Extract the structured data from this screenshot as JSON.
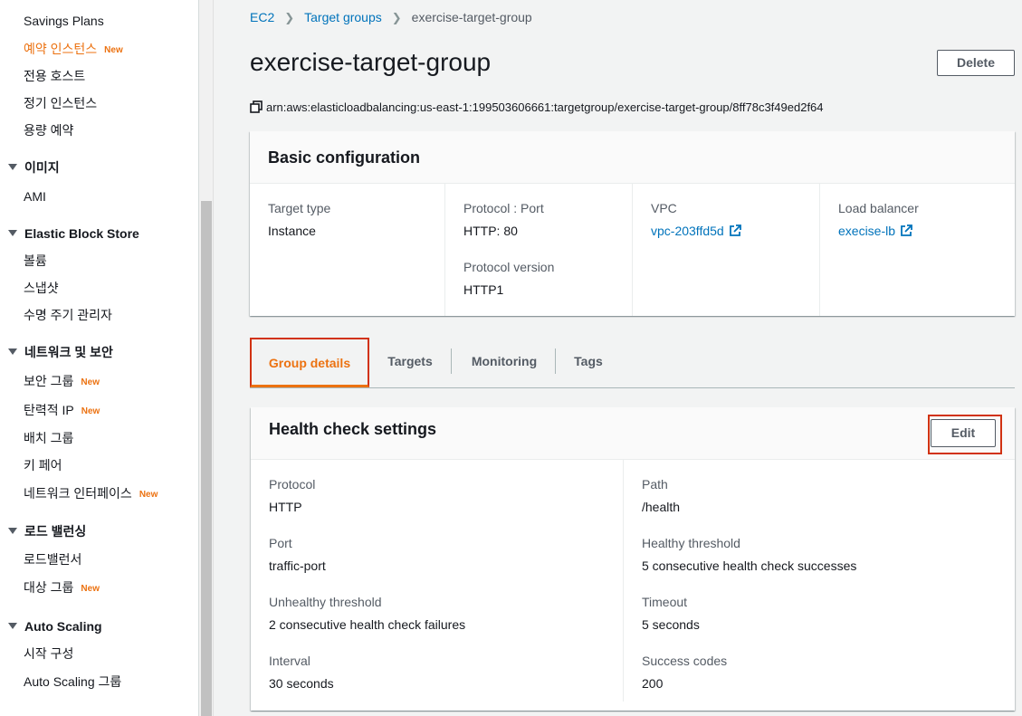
{
  "sidebar": {
    "items": [
      {
        "label": "Savings Plans",
        "active": false,
        "new": ""
      },
      {
        "label": "예약 인스턴스",
        "active": true,
        "new": "New"
      },
      {
        "label": "전용 호스트",
        "active": false,
        "new": ""
      },
      {
        "label": "정기 인스턴스",
        "active": false,
        "new": ""
      },
      {
        "label": "용량 예약",
        "active": false,
        "new": ""
      }
    ],
    "sections": {
      "images": {
        "title": "이미지",
        "items": [
          "AMI"
        ]
      },
      "ebs": {
        "title": "Elastic Block Store",
        "items": [
          "볼륨",
          "스냅샷",
          "수명 주기 관리자"
        ]
      },
      "network": {
        "title": "네트워크 및 보안",
        "items": [
          "보안 그룹",
          "탄력적 IP",
          "배치 그룹",
          "키 페어",
          "네트워크 인터페이스"
        ]
      },
      "lb": {
        "title": "로드 밸런싱",
        "items": [
          "로드밸런서",
          "대상 그룹"
        ]
      },
      "autoscaling": {
        "title": "Auto Scaling",
        "items": [
          "시작 구성",
          "Auto Scaling 그룹"
        ]
      }
    },
    "new_badge": "New"
  },
  "breadcrumb": {
    "root": "EC2",
    "parent": "Target groups",
    "current": "exercise-target-group"
  },
  "page": {
    "title": "exercise-target-group",
    "delete_label": "Delete",
    "arn": "arn:aws:elasticloadbalancing:us-east-1:199503606661:targetgroup/exercise-target-group/8ff78c3f49ed2f64"
  },
  "basic": {
    "title": "Basic configuration",
    "target_type_label": "Target type",
    "target_type_value": "Instance",
    "protocol_port_label": "Protocol : Port",
    "protocol_port_value": "HTTP: 80",
    "protocol_version_label": "Protocol version",
    "protocol_version_value": "HTTP1",
    "vpc_label": "VPC",
    "vpc_value": "vpc-203ffd5d",
    "lb_label": "Load balancer",
    "lb_value": "execise-lb"
  },
  "tabs": [
    "Group details",
    "Targets",
    "Monitoring",
    "Tags"
  ],
  "health": {
    "title": "Health check settings",
    "edit_label": "Edit",
    "left": [
      {
        "label": "Protocol",
        "value": "HTTP"
      },
      {
        "label": "Port",
        "value": "traffic-port"
      },
      {
        "label": "Unhealthy threshold",
        "value": "2 consecutive health check failures"
      },
      {
        "label": "Interval",
        "value": "30 seconds"
      }
    ],
    "right": [
      {
        "label": "Path",
        "value": "/health"
      },
      {
        "label": "Healthy threshold",
        "value": "5 consecutive health check successes"
      },
      {
        "label": "Timeout",
        "value": "5 seconds"
      },
      {
        "label": "Success codes",
        "value": "200"
      }
    ]
  },
  "colors": {
    "accent": "#ec7211",
    "link": "#0073bb",
    "highlight": "#d13212"
  }
}
